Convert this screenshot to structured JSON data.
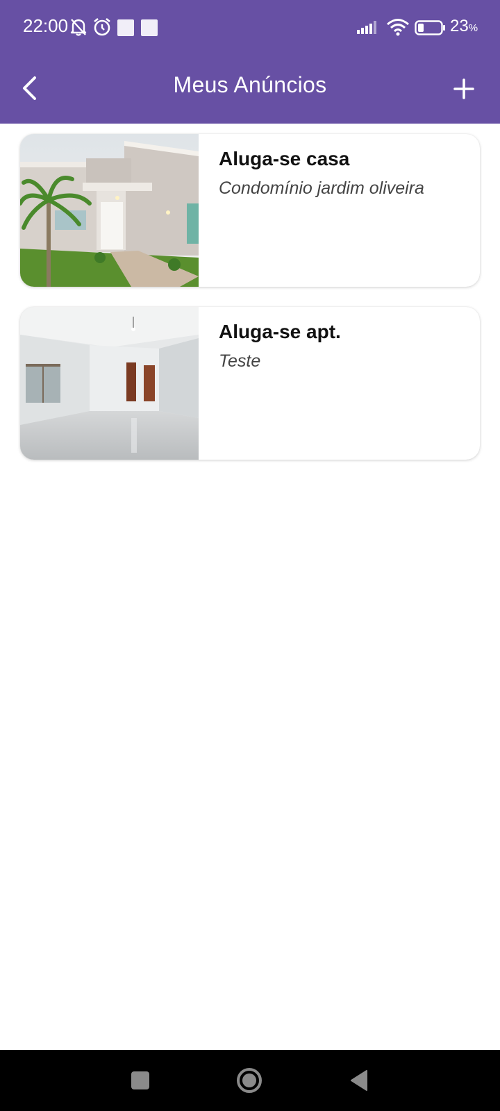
{
  "status_bar": {
    "time": "22:00",
    "battery_percent": "23",
    "battery_unit": "%"
  },
  "app_bar": {
    "title": "Meus Anúncios",
    "back_icon": "chevron-left-icon",
    "add_icon": "plus-icon"
  },
  "listings": [
    {
      "title": "Aluga-se casa",
      "subtitle": "Condomínio jardim oliveira",
      "image": "house-exterior-photo"
    },
    {
      "title": "Aluga-se apt.",
      "subtitle": "Teste",
      "image": "apartment-interior-photo"
    }
  ],
  "nav_bar": {
    "recents_icon": "square-icon",
    "home_icon": "circle-icon",
    "back_icon": "triangle-back-icon"
  },
  "colors": {
    "primary": "#6750a4",
    "background": "#ffffff",
    "nav_bar": "#000000"
  }
}
